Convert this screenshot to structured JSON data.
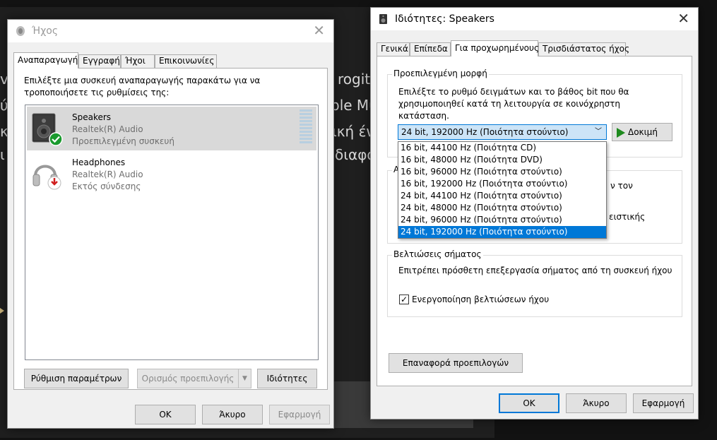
{
  "background": {
    "fragments": [
      "rogit",
      "ple Mu",
      "ική έν",
      "διαφο",
      "v",
      "ύ",
      "κ",
      "ι"
    ]
  },
  "sound_dialog": {
    "title": "Ήχος",
    "tabs": [
      "Αναπαραγωγή",
      "Εγγραφή",
      "Ήχοι",
      "Επικοινωνίες"
    ],
    "instruction": "Επιλέξτε μια συσκευή αναπαραγωγής παρακάτω για να τροποποιήσετε τις ρυθμίσεις της:",
    "devices": [
      {
        "name": "Speakers",
        "driver": "Realtek(R) Audio",
        "status": "Προεπιλεγμένη συσκευή",
        "status_icon": "green-check-icon"
      },
      {
        "name": "Headphones",
        "driver": "Realtek(R) Audio",
        "status": "Εκτός σύνδεσης",
        "status_icon": "red-down-arrow-icon"
      }
    ],
    "buttons": {
      "configure": "Ρύθμιση παραμέτρων",
      "set_default": "Ορισμός προεπιλογής",
      "properties": "Ιδιότητες",
      "ok": "OK",
      "cancel": "Άκυρο",
      "apply": "Εφαρμογή"
    }
  },
  "properties_dialog": {
    "title": "Ιδιότητες: Speakers",
    "tabs": [
      "Γενικά",
      "Επίπεδα",
      "Για προχωρημένους",
      "Τρισδιάστατος ήχος"
    ],
    "default_format": {
      "label": "Προεπιλεγμένη μορφή",
      "description": "Επιλέξτε το ρυθμό δειγμάτων και το βάθος bit που θα χρησιμοποιηθεί κατά τη λειτουργία σε κοινόχρηστη κατάσταση.",
      "selected": "24 bit, 192000 Hz (Ποιότητα στούντιο)",
      "test_button": "Δοκιμή",
      "options": [
        "16 bit, 44100 Hz (Ποιότητα CD)",
        "16 bit, 48000 Hz (Ποιότητα DVD)",
        "16 bit, 96000 Hz (Ποιότητα στούντιο)",
        "16 bit, 192000 Hz (Ποιότητα στούντιο)",
        "24 bit, 44100 Hz (Ποιότητα στούντιο)",
        "24 bit, 48000 Hz (Ποιότητα στούντιο)",
        "24 bit, 96000 Hz (Ποιότητα στούντιο)",
        "24 bit, 192000 Hz (Ποιότητα στούντιο)"
      ]
    },
    "exclusive_group": {
      "label_fragment": "Α",
      "text_fragment_1": "ν τον",
      "text_fragment_2": "ειστικής"
    },
    "enhancements": {
      "label": "Βελτιώσεις σήματος",
      "description": "Επιτρέπει πρόσθετη επεξεργασία σήματος από τη συσκευή ήχου",
      "checkbox_label": "Ενεργοποίηση βελτιώσεων ήχου",
      "checked": true
    },
    "buttons": {
      "restore_defaults": "Επαναφορά προεπιλογών",
      "ok": "OK",
      "cancel": "Άκυρο",
      "apply": "Εφαρμογή"
    }
  }
}
